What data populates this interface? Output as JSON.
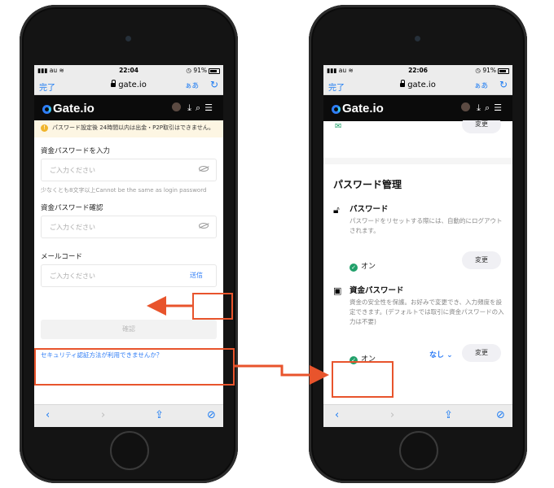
{
  "left": {
    "status": {
      "carrier": "au",
      "time": "22:04",
      "battery": "91%"
    },
    "browser": {
      "done": "完了",
      "url": "gate.io",
      "text_size": "ぁあ"
    },
    "brand": "Gate.io",
    "notice": "パスワード設定後 24時間以内は出金・P2P取引はできません。",
    "fund_password": {
      "label": "資金パスワードを入力",
      "placeholder": "ご入力ください",
      "hint": "少なくとも8文字以上Cannot be the same as login password"
    },
    "confirm_password": {
      "label": "資金パスワード確認",
      "placeholder": "ご入力ください"
    },
    "email_code": {
      "label": "メールコード",
      "placeholder": "ご入力ください",
      "send": "送信"
    },
    "confirm_button": "確認",
    "security_link": "セキュリティ認証方法が利用できませんか？"
  },
  "right": {
    "status": {
      "carrier": "au",
      "time": "22:06",
      "battery": "91%"
    },
    "browser": {
      "done": "完了",
      "url": "gate.io",
      "text_size": "ぁあ"
    },
    "brand": "Gate.io",
    "top_change": "変更",
    "section_title": "パスワード管理",
    "password": {
      "title": "パスワード",
      "desc": "パスワードをリセットする際には、自動的にログアウトされます。",
      "status": "オン",
      "change": "変更"
    },
    "fund_password": {
      "title": "資金パスワード",
      "desc": "資金の安全性を保護。お好みで変更でき、入力頻度を設定できます。(デフォルトでは取引に資金パスワードの入力は不要)",
      "status": "オン",
      "frequency": "なし",
      "change": "変更"
    }
  },
  "colors": {
    "highlight": "#e8542c",
    "link": "#2f7df6",
    "ok": "#21a06a"
  }
}
